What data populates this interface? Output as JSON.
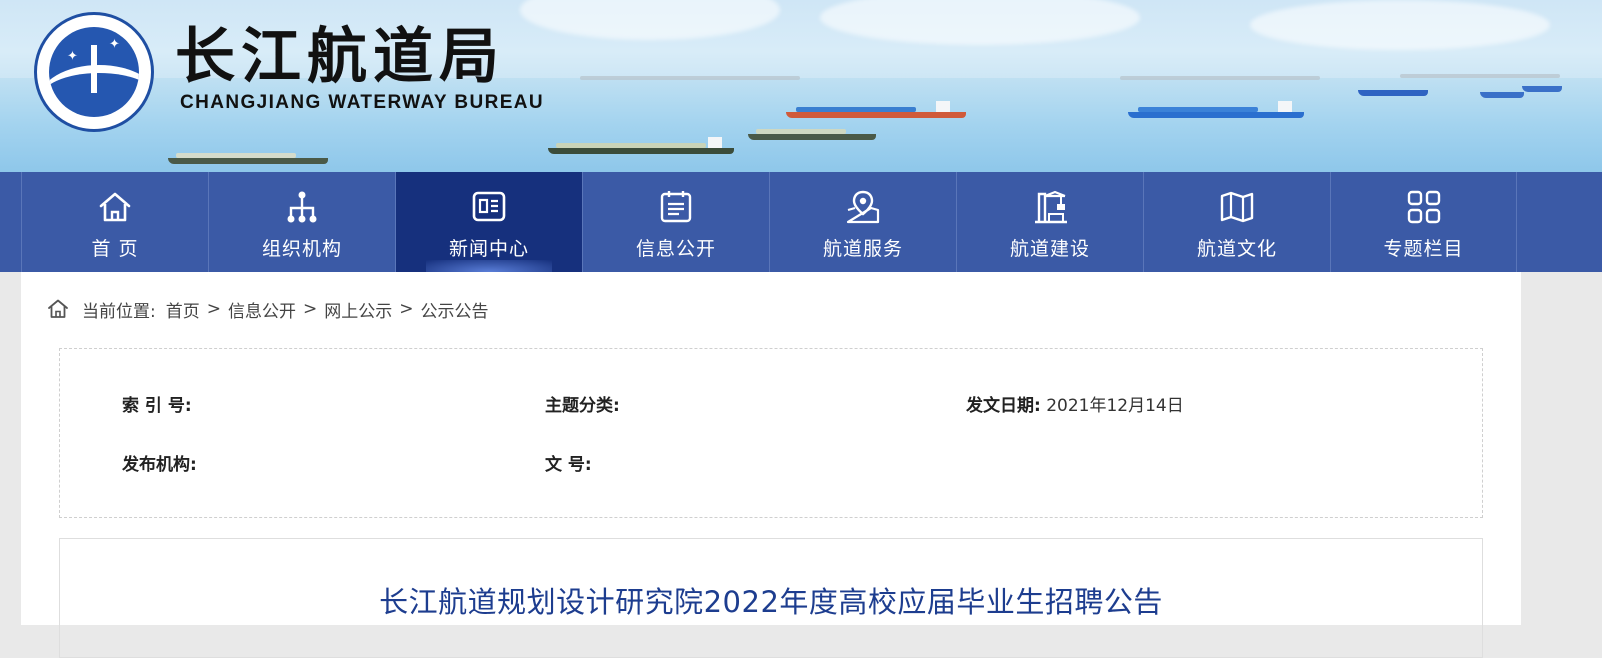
{
  "header": {
    "title_cn": "长江航道局",
    "title_en": "CHANGJIANG WATERWAY BUREAU",
    "logo_text": "长江航道局",
    "logo_ring_text": "CHANGJIANG WATERWAY"
  },
  "nav": {
    "items": [
      {
        "label": "首 页",
        "icon": "home-icon"
      },
      {
        "label": "组织机构",
        "icon": "org-chart-icon"
      },
      {
        "label": "新闻中心",
        "icon": "news-icon",
        "active": true
      },
      {
        "label": "信息公开",
        "icon": "document-list-icon"
      },
      {
        "label": "航道服务",
        "icon": "map-pin-icon"
      },
      {
        "label": "航道建设",
        "icon": "crane-icon"
      },
      {
        "label": "航道文化",
        "icon": "book-icon"
      },
      {
        "label": "专题栏目",
        "icon": "grid-icon"
      }
    ]
  },
  "breadcrumb": {
    "prefix": "当前位置:",
    "items": [
      "首页",
      "信息公开",
      "网上公示",
      "公示公告"
    ],
    "separator": ">"
  },
  "meta": {
    "index_label": "索 引 号:",
    "index_value": "",
    "topic_label": "主题分类:",
    "topic_value": "",
    "date_label": "发文日期:",
    "date_value": "2021年12月14日",
    "publisher_label": "发布机构:",
    "publisher_value": "",
    "doc_no_label": "文 号:",
    "doc_no_value": ""
  },
  "article": {
    "title": "长江航道规划设计研究院2022年度高校应届毕业生招聘公告"
  },
  "colors": {
    "nav_bg": "#3b5aa6",
    "nav_active": "#16307d",
    "title_blue": "#1d3d8f"
  }
}
